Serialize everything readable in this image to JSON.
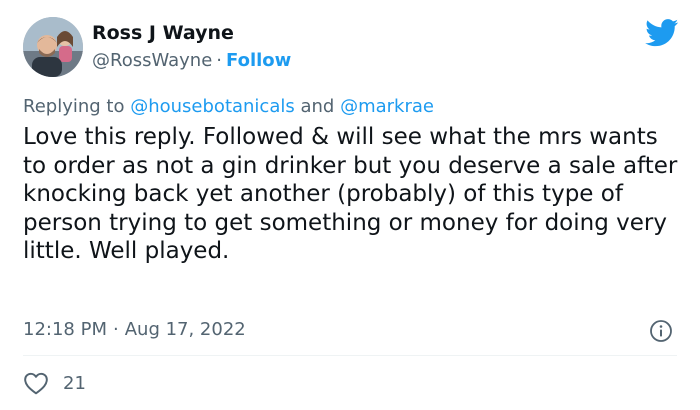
{
  "author": {
    "name": "Ross J Wayne",
    "handle": "@RossWayne",
    "separator": "·",
    "follow_label": "Follow"
  },
  "reply_context": {
    "prefix": "Replying to",
    "mention_1": "@housebotanicals",
    "joiner": "and",
    "mention_2": "@markrae"
  },
  "tweet": {
    "text": "Love this reply. Followed & will see what the mrs wants to order as not a gin drinker but you deserve a sale after knocking back yet another (probably) of this type of person trying to get something or money for doing very little. Well played."
  },
  "meta": {
    "time": "12:18 PM",
    "separator": "·",
    "date": "Aug 17, 2022"
  },
  "engagement": {
    "likes": "21"
  },
  "icons": {
    "brand": "twitter-bird-icon",
    "info": "info-icon",
    "like": "heart-icon"
  },
  "colors": {
    "brand_blue": "#1d9bf0",
    "text": "#0f1419",
    "muted": "#536471"
  }
}
